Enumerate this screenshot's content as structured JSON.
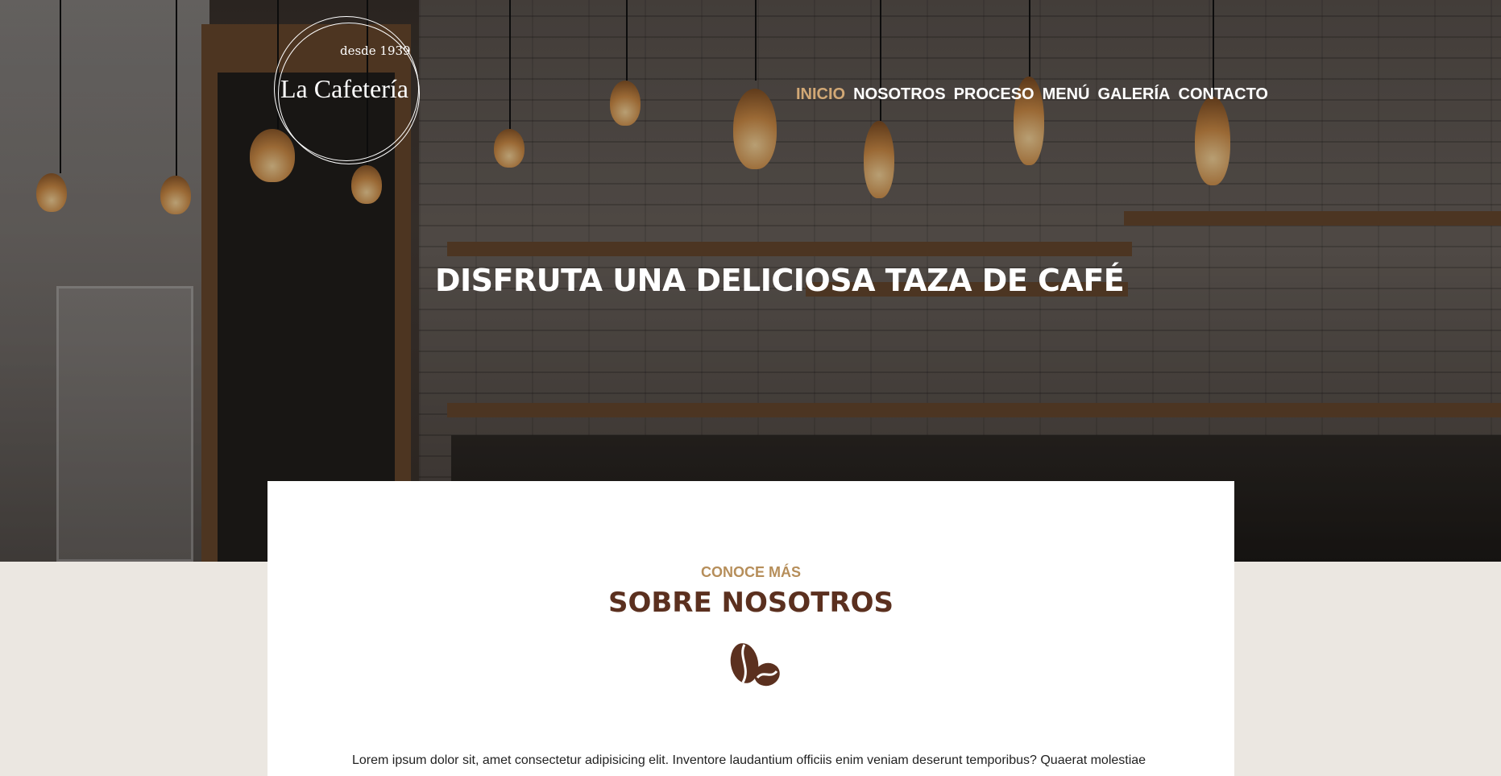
{
  "brand": {
    "since": "desde 1939",
    "name": "La Cafetería"
  },
  "nav": {
    "items": [
      {
        "label": "INICIO",
        "active": true
      },
      {
        "label": "NOSOTROS",
        "active": false
      },
      {
        "label": "PROCESO",
        "active": false
      },
      {
        "label": "MENÚ",
        "active": false
      },
      {
        "label": "GALERÍA",
        "active": false
      },
      {
        "label": "CONTACTO",
        "active": false
      }
    ]
  },
  "hero": {
    "title": "DISFRUTA UNA DELICIOSA TAZA DE CAFÉ"
  },
  "about": {
    "eyebrow": "CONOCE MÁS",
    "title": "SOBRE NOSOTROS",
    "icon": "coffee-beans-icon",
    "text": "Lorem ipsum dolor sit, amet consectetur adipisicing elit. Inventore laudantium officiis enim veniam deserunt temporibus? Quaerat molestiae"
  },
  "colors": {
    "accent": "#d2a875",
    "eyebrow": "#b68e5a",
    "title": "#5b301f",
    "page_bg": "#ebe7e1"
  }
}
